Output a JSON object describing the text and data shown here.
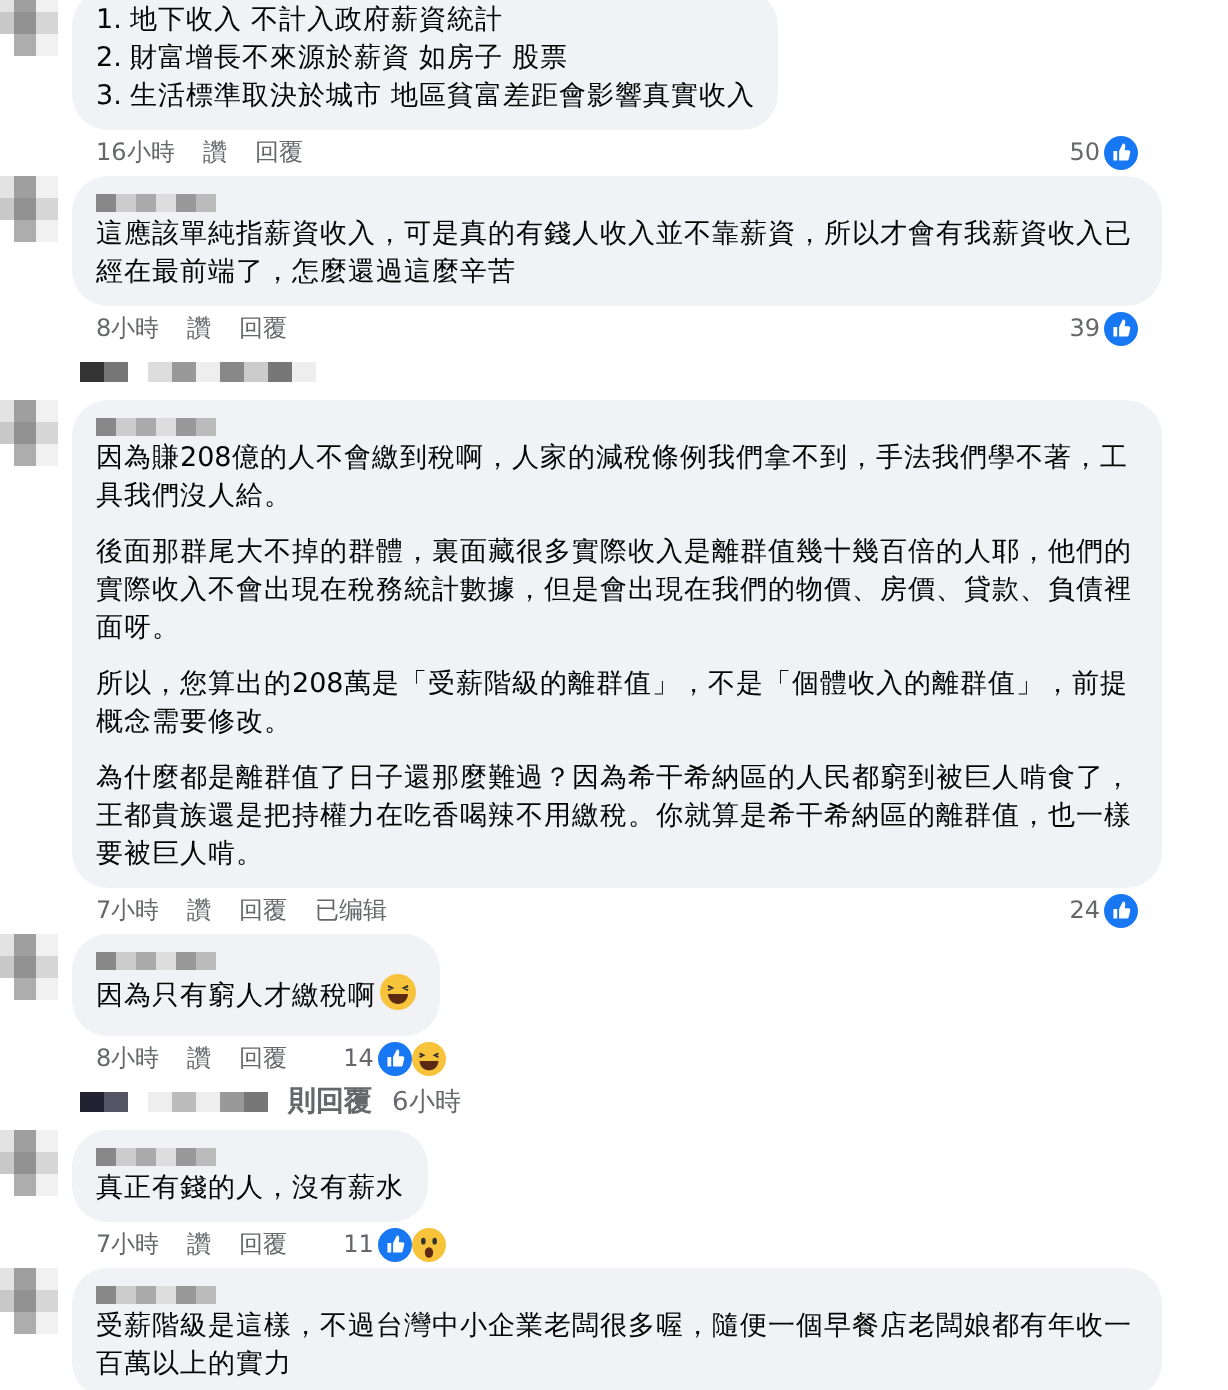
{
  "comments": [
    {
      "kind": "comment",
      "paragraphs": [
        "1. 地下收入 不計入政府薪資統計\n2. 財富增長不來源於薪資 如房子 股票\n3. 生活標準取決於城市 地區貧富差距會影響真實收入"
      ],
      "time": "16小時",
      "like": "讚",
      "reply": "回覆",
      "reaction_count": "50",
      "reactions": [
        {
          "kind": "like"
        }
      ]
    },
    {
      "kind": "comment",
      "paragraphs": [
        "這應該單純指薪資收入，可是真的有錢人收入並不靠薪資，所以才會有我薪資收入已經在最前端了，怎麼還過這麼辛苦"
      ],
      "time": "8小時",
      "like": "讚",
      "reply": "回覆",
      "reaction_count": "39",
      "reactions": [
        {
          "kind": "like"
        }
      ]
    },
    {
      "kind": "hidden"
    },
    {
      "kind": "comment",
      "paragraphs": [
        "因為賺208億的人不會繳到稅啊，人家的減稅條例我們拿不到，手法我們學不著，工具我們沒人給。",
        "後面那群尾大不掉的群體，裏面藏很多實際收入是離群值幾十幾百倍的人耶，他們的實際收入不會出現在稅務統計數據，但是會出現在我們的物價、房價、貸款、負債裡面呀。",
        "所以，您算出的208萬是「受薪階級的離群值」，不是「個體收入的離群值」，前提概念需要修改。",
        "為什麼都是離群值了日子還那麼難過？因為希干希納區的人民都窮到被巨人啃食了，王都貴族還是把持權力在吃香喝辣不用繳稅。你就算是希干希納區的離群值，也一樣要被巨人啃。"
      ],
      "time": "7小時",
      "like": "讚",
      "reply": "回覆",
      "edited": "已编辑",
      "reaction_count": "24",
      "reactions": [
        {
          "kind": "like"
        }
      ]
    },
    {
      "kind": "comment",
      "paragraphs": [
        "因為只有窮人才繳稅啊"
      ],
      "emoji": {
        "kind": "haha"
      },
      "time": "8小時",
      "like": "讚",
      "reply": "回覆",
      "reaction_count": "14",
      "reactions": [
        {
          "kind": "like"
        },
        {
          "kind": "haha"
        }
      ]
    },
    {
      "kind": "more",
      "label": "則回覆",
      "time": "6小時"
    },
    {
      "kind": "comment",
      "paragraphs": [
        "真正有錢的人，沒有薪水"
      ],
      "time": "7小時",
      "like": "讚",
      "reply": "回覆",
      "reaction_count": "11",
      "reactions": [
        {
          "kind": "like"
        },
        {
          "kind": "wow"
        }
      ]
    },
    {
      "kind": "comment",
      "paragraphs": [
        "受薪階級是這樣，不過台灣中小企業老闆很多喔，隨便一個早餐店老闆娘都有年收一百萬以上的實力"
      ]
    }
  ]
}
